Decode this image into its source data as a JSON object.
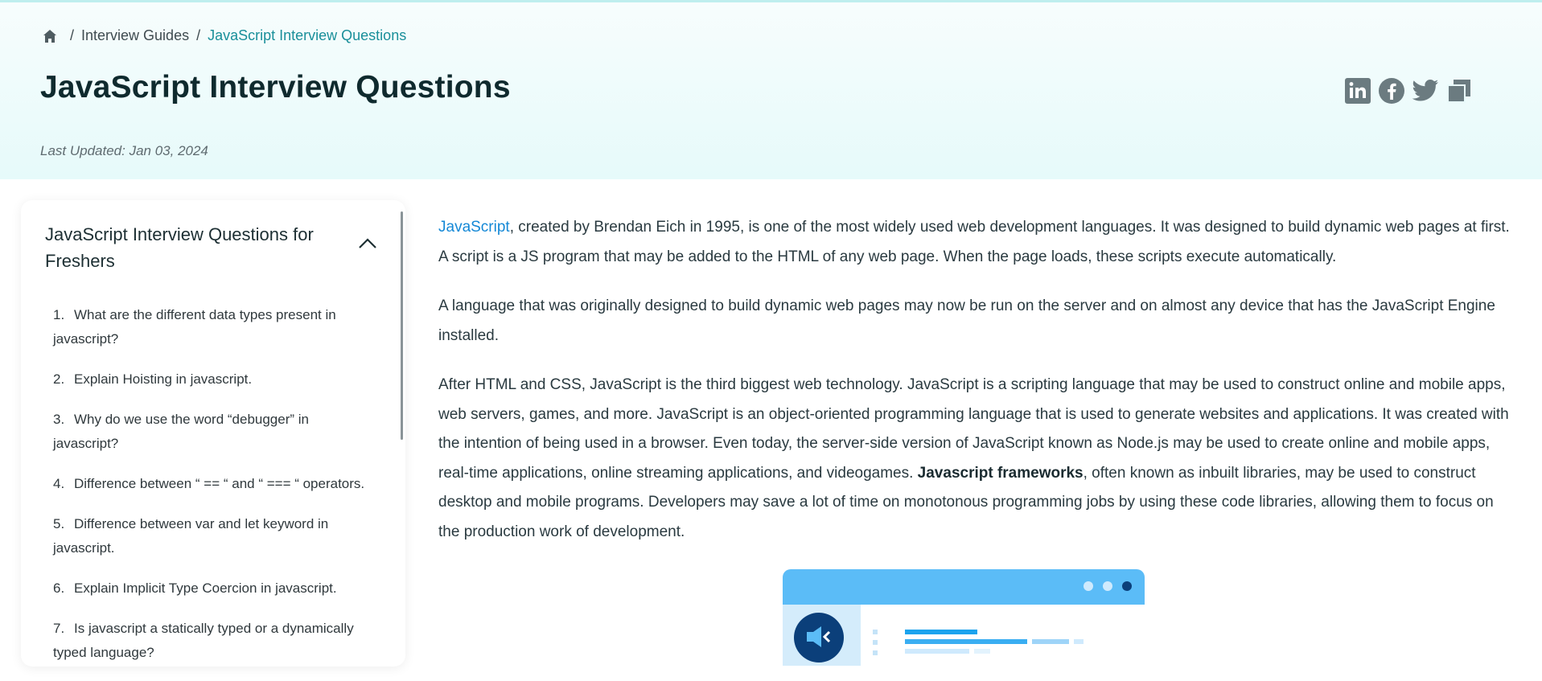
{
  "breadcrumb": {
    "home_icon": "home-icon",
    "items": [
      "Interview Guides",
      "JavaScript Interview Questions"
    ]
  },
  "page": {
    "title": "JavaScript Interview Questions",
    "last_updated": "Last Updated: Jan 03, 2024"
  },
  "share": {
    "icons": [
      "linkedin-icon",
      "facebook-icon",
      "twitter-icon",
      "copy-link-icon"
    ],
    "color": "#6b7b80"
  },
  "toc": {
    "heading": "JavaScript Interview Questions for Freshers",
    "toggle_icon": "chevron-up-icon",
    "items": [
      {
        "num": "1.",
        "label": "What are the different data types present in javascript?"
      },
      {
        "num": "2.",
        "label": "Explain Hoisting in javascript."
      },
      {
        "num": "3.",
        "label": "Why do we use the word “debugger” in javascript?"
      },
      {
        "num": "4.",
        "label": "Difference between “ == “ and “ === “ operators."
      },
      {
        "num": "5.",
        "label": "Difference between var and let keyword in javascript."
      },
      {
        "num": "6.",
        "label": "Explain Implicit Type Coercion in javascript."
      },
      {
        "num": "7.",
        "label": "Is javascript a statically typed or a dynamically typed language?"
      }
    ]
  },
  "article": {
    "p1_link": "JavaScript",
    "p1_text": ", created by Brendan Eich in 1995, is one of the most widely used web development languages. It was designed to build dynamic web pages at first. A script is a JS program that may be added to the HTML of any web page. When the page loads, these scripts execute automatically.",
    "p2": "A language that was originally designed to build dynamic web pages may now be run on the server and on almost any device that has the JavaScript Engine installed.",
    "p3_before": "After HTML and CSS, JavaScript is the third biggest web technology. JavaScript is a scripting language that may be used to construct online and mobile apps, web servers, games, and more. JavaScript is an object-oriented programming language that is used to generate websites and applications. It was created with the intention of being used in a browser. Even today, the server-side version of JavaScript known as Node.js may be used to create online and mobile apps, real-time applications, online streaming applications, and videogames. ",
    "p3_bold": "Javascript frameworks",
    "p3_after": ", often known as inbuilt libraries, may be used to construct desktop and mobile programs. Developers may save a lot of time on monotonous programming jobs by using these code libraries, allowing them to focus on the production work of development."
  },
  "colors": {
    "accent": "#1a8f9a",
    "link": "#1488d6",
    "hero_bg": "#e6fafa",
    "illustration_blue": "#5bbcf7"
  }
}
